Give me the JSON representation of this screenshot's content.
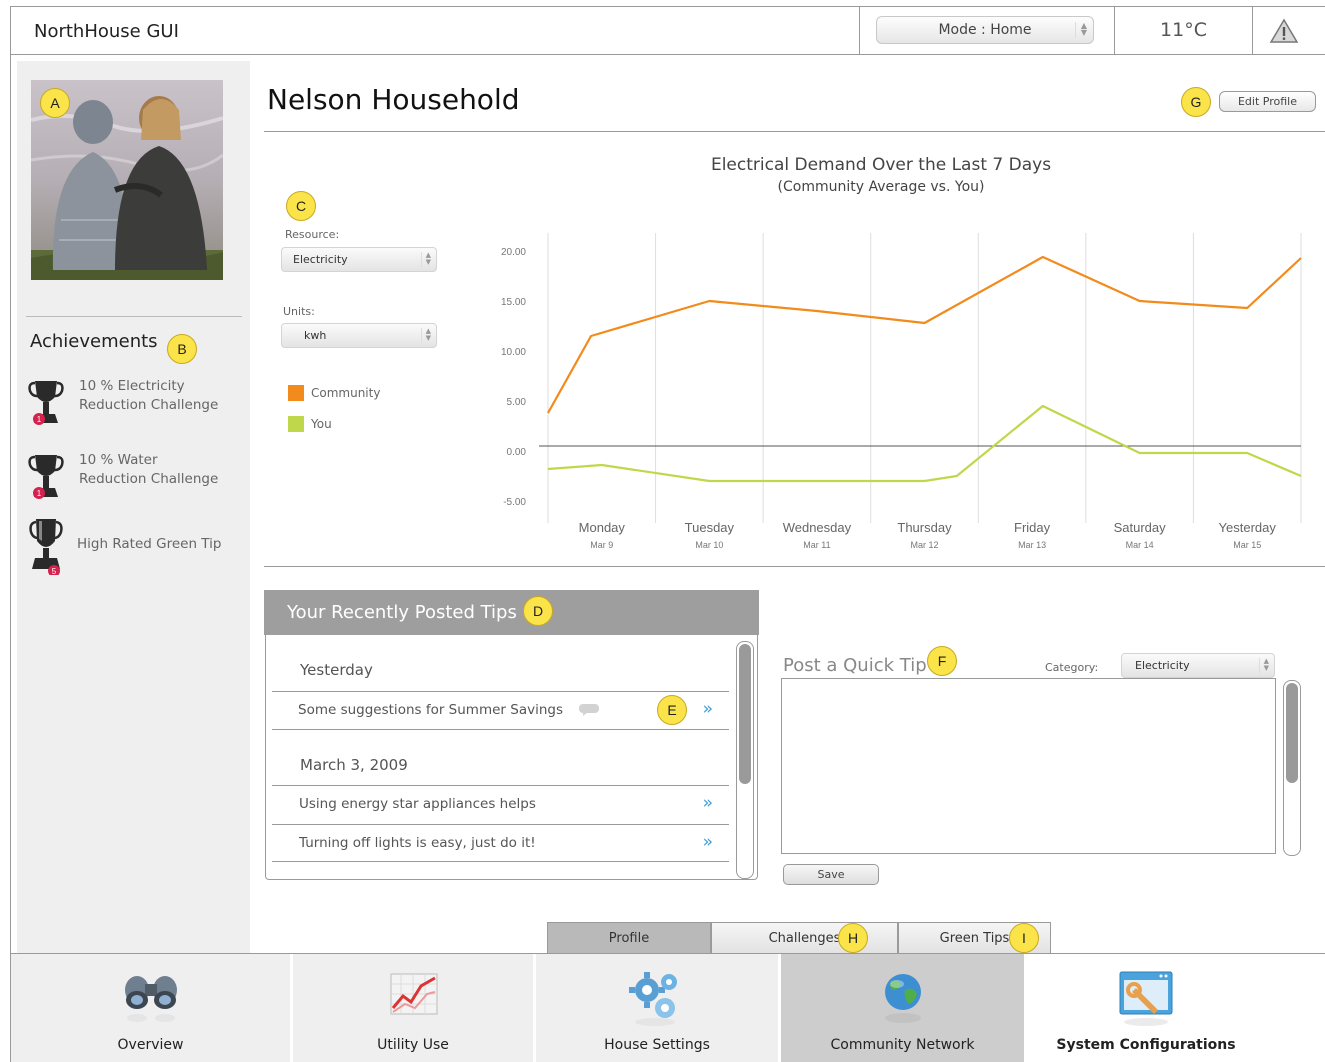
{
  "header": {
    "app_title": "NorthHouse GUI",
    "mode_label": "Mode : Home",
    "temperature": "11°C",
    "alert_icon": "warning-icon"
  },
  "sidebar": {
    "badge_photo": "A",
    "badge_achievements": "B",
    "achievements_title": "Achievements",
    "achievements": [
      {
        "line1": "10 %  Electricity",
        "line2": "Reduction Challenge",
        "count": "1",
        "icon": "trophy-icon"
      },
      {
        "line1": "10 %  Water",
        "line2": "Reduction Challenge",
        "count": "1",
        "icon": "trophy-icon"
      },
      {
        "line1": "High Rated Green Tip",
        "line2": "",
        "count": "5",
        "icon": "trophy-icon"
      }
    ]
  },
  "profile": {
    "household_name": "Nelson Household",
    "badge_edit": "G",
    "edit_profile_label": "Edit Profile"
  },
  "controls": {
    "badge_controls": "C",
    "resource_label": "Resource:",
    "resource_value": "Electricity",
    "units_label": "Units:",
    "units_value": "kwh"
  },
  "chart_data": {
    "type": "line",
    "title": "Electrical Demand Over the Last 7 Days",
    "subtitle": "(Community Average vs. You)",
    "categories": [
      "Monday",
      "Tuesday",
      "Wednesday",
      "Thursday",
      "Friday",
      "Saturday",
      "Yesterday"
    ],
    "category_dates": [
      "Mar 9",
      "Mar 10",
      "Mar 11",
      "Mar 12",
      "Mar 13",
      "Mar 14",
      "Mar 15"
    ],
    "y_ticks": [
      "20.00",
      "15.00",
      "10.00",
      "5.00",
      "0.00",
      "-5.00"
    ],
    "ylim": [
      -5,
      20
    ],
    "series": [
      {
        "name": "Community",
        "color": "#f28a1c",
        "x": [
          0,
          0.4,
          1.5,
          2.5,
          3.5,
          4.6,
          5.5,
          6.5,
          7.0
        ],
        "values": [
          3.8,
          11.5,
          15.0,
          14.0,
          12.8,
          19.4,
          15.0,
          14.3,
          19.3
        ]
      },
      {
        "name": "You",
        "color": "#bfd74a",
        "x": [
          0,
          0.5,
          1.5,
          2.5,
          3.5,
          3.8,
          4.6,
          5.5,
          6.5,
          7.0
        ],
        "values": [
          -1.8,
          -1.4,
          -3.0,
          -3.0,
          -3.0,
          -2.5,
          4.5,
          -0.2,
          -0.2,
          -2.5
        ]
      }
    ],
    "baseline": 0.5,
    "grid": "vertical",
    "legend": "left"
  },
  "tips": {
    "header": "Your Recently Posted Tips",
    "badge_tips": "D",
    "badge_row": "E",
    "groups": [
      {
        "date": "Yesterday",
        "items": [
          "Some suggestions for Summer Savings"
        ]
      },
      {
        "date": "March 3, 2009",
        "items": [
          "Using energy star appliances helps",
          "Turning off lights is easy, just do it!"
        ]
      }
    ]
  },
  "quick_tip": {
    "title": "Post a Quick Tip",
    "badge": "F",
    "category_label": "Category:",
    "category_value": "Electricity",
    "save_label": "Save"
  },
  "subtabs": {
    "items": [
      "Profile",
      "Challenges",
      "Green Tips"
    ],
    "badge_challenges": "H",
    "badge_greentips": "I"
  },
  "bottom_nav": {
    "items": [
      {
        "label": "Overview",
        "icon": "binoculars-icon"
      },
      {
        "label": "Utility Use",
        "icon": "graph-icon"
      },
      {
        "label": "House Settings",
        "icon": "gears-icon"
      },
      {
        "label": "Community Network",
        "icon": "globe-icon"
      },
      {
        "label": "System Configurations",
        "icon": "wrench-window-icon"
      }
    ]
  }
}
